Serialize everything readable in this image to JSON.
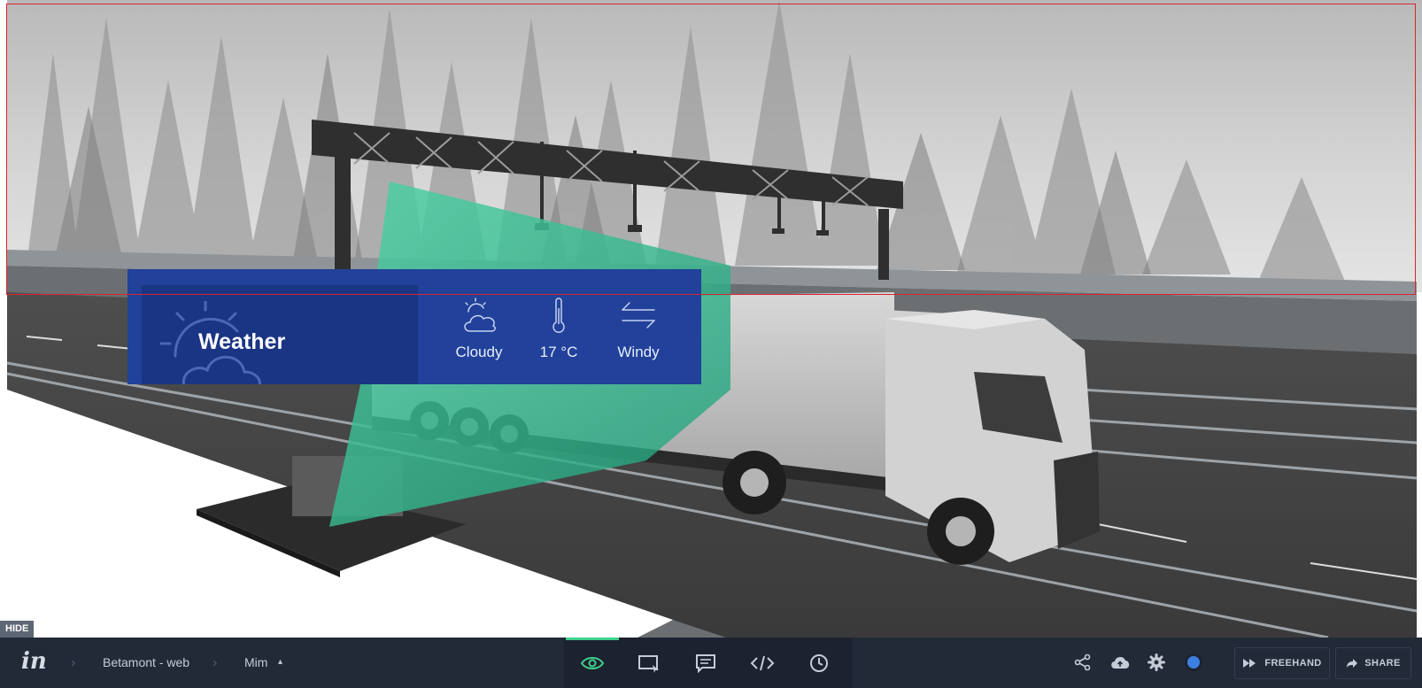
{
  "weather": {
    "title": "Weather",
    "metrics": [
      {
        "icon": "cloudy-icon",
        "label": "Cloudy"
      },
      {
        "icon": "thermometer-icon",
        "label": "17 °C"
      },
      {
        "icon": "wind-icon",
        "label": "Windy"
      }
    ]
  },
  "hide_label": "HIDE",
  "toolbar": {
    "logo": "in",
    "breadcrumb": [
      "Betamont - web",
      "Mim"
    ],
    "tools": [
      "preview-icon",
      "inspect-icon",
      "comment-icon",
      "code-icon",
      "history-icon"
    ],
    "right_icons": [
      "share-network-icon",
      "cloud-upload-icon",
      "gear-icon",
      "status-dot-icon"
    ],
    "freehand_label": "FREEHAND",
    "share_label": "SHARE",
    "colors": {
      "bar": "#222a38",
      "active": "#3ed08a",
      "accent": "#3d7fe0",
      "panel": "#21419a"
    }
  }
}
